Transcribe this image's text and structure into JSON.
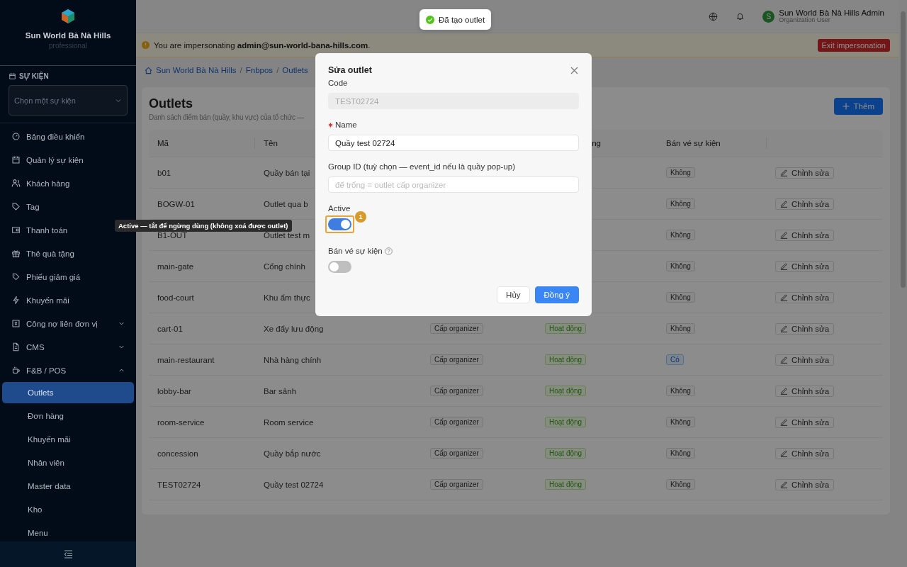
{
  "sidebar": {
    "brand": "Sun World Bà Nà Hills",
    "plan": "professional",
    "section_label": "SỰ KIỆN",
    "event_select": {
      "placeholder": "Chọn một sự kiện"
    },
    "items": [
      {
        "label": "Bảng điều khiển",
        "selected": false
      },
      {
        "label": "Quản lý sự kiện",
        "selected": false
      },
      {
        "label": "Khách hàng",
        "selected": false
      },
      {
        "label": "Tag",
        "selected": false
      },
      {
        "label": "Thanh toán",
        "selected": false
      },
      {
        "label": "Thẻ quà tặng",
        "selected": false
      },
      {
        "label": "Phiếu giảm giá",
        "selected": false
      },
      {
        "label": "Khuyến mãi",
        "selected": false
      },
      {
        "label": "Công nợ liên đơn vị",
        "selected": false,
        "expanded": false
      },
      {
        "label": "CMS",
        "selected": false,
        "expanded": false
      },
      {
        "label": "F&B / POS",
        "selected": false,
        "expanded": true,
        "children": [
          {
            "label": "Outlets",
            "selected": true
          },
          {
            "label": "Đơn hàng",
            "selected": false
          },
          {
            "label": "Khuyến mãi",
            "selected": false
          },
          {
            "label": "Nhân viên",
            "selected": false
          },
          {
            "label": "Master data",
            "selected": false
          },
          {
            "label": "Kho",
            "selected": false
          },
          {
            "label": "Menu",
            "selected": false
          }
        ]
      }
    ]
  },
  "header": {
    "user_initial": "S",
    "user_name": "Sun World Bà Nà Hills Admin",
    "user_role": "Organization User"
  },
  "toast": "Đã tạo outlet",
  "banner": {
    "message": "You are impersonating **admin@sun-world-bana-hills.com**.",
    "button": "Exit impersonation"
  },
  "breadcrumb": [
    "Sun World Bà Nà Hills",
    "/",
    "Fnbpos",
    "/",
    "Outlets"
  ],
  "page": {
    "title": "Outlets",
    "subtitle": "Danh sách điểm bán (quầy, khu vực) của tổ chức —",
    "add_button": "Thêm"
  },
  "table": {
    "columns": [
      {
        "label": "Mã"
      },
      {
        "label": "Tên"
      },
      {},
      {
        "label": "ng",
        "clipped": true
      },
      {
        "label": "Bán vé sự kiện"
      },
      {}
    ],
    "rows": [
      {
        "code": "b01",
        "name": "Quầy bán tại",
        "ticket": {
          "label": "Không",
          "on": false
        },
        "action": "Chỉnh sửa"
      },
      {
        "code": "BOGW-01",
        "name": "Outlet qua b",
        "ticket": {
          "label": "Không",
          "on": false
        },
        "action": "Chỉnh sửa"
      },
      {
        "code": "B1-OUT",
        "name": "Outlet test m",
        "ticket": {
          "label": "Không",
          "on": false
        },
        "action": "Chỉnh sửa"
      },
      {
        "code": "main-gate",
        "name": "Cổng chính",
        "ticket": {
          "label": "Không",
          "on": false
        },
        "action": "Chỉnh sửa"
      },
      {
        "code": "food-court",
        "name": "Khu ẩm thực",
        "ticket": {
          "label": "Không",
          "on": false
        },
        "action": "Chỉnh sửa"
      },
      {
        "code": "cart-01",
        "name": "Xe đẩy lưu động",
        "scope": "Cấp organizer",
        "status": "Hoạt động",
        "ticket": {
          "label": "Không",
          "on": false
        },
        "action": "Chỉnh sửa"
      },
      {
        "code": "main-restaurant",
        "name": "Nhà hàng chính",
        "scope": "Cấp organizer",
        "status": "Hoạt động",
        "ticket": {
          "label": "Có",
          "on": true
        },
        "action": "Chỉnh sửa"
      },
      {
        "code": "lobby-bar",
        "name": "Bar sảnh",
        "scope": "Cấp organizer",
        "status": "Hoạt động",
        "ticket": {
          "label": "Không",
          "on": false
        },
        "action": "Chỉnh sửa"
      },
      {
        "code": "room-service",
        "name": "Room service",
        "scope": "Cấp organizer",
        "status": "Hoạt động",
        "ticket": {
          "label": "Không",
          "on": false
        },
        "action": "Chỉnh sửa"
      },
      {
        "code": "concession",
        "name": "Quầy bắp nước",
        "scope": "Cấp organizer",
        "status": "Hoạt động",
        "ticket": {
          "label": "Không",
          "on": false
        },
        "action": "Chỉnh sửa"
      },
      {
        "code": "TEST02724",
        "name": "Quầy test 02724",
        "scope": "Cấp organizer",
        "status": "Hoạt động",
        "ticket": {
          "label": "Không",
          "on": false
        },
        "action": "Chỉnh sửa"
      }
    ]
  },
  "modal": {
    "title": "Sửa outlet",
    "fields": [
      {
        "kind": "text",
        "label": "Code",
        "value": "TEST02724",
        "disabled": true,
        "required": false
      },
      {
        "kind": "text",
        "label": "Name",
        "value": "Quầy test 02724",
        "disabled": false,
        "required": true
      },
      {
        "kind": "text",
        "label": "Group ID (tuỳ chọn — event_id nếu là quầy pop-up)",
        "placeholder": "để trống = outlet cấp organizer",
        "disabled": false,
        "required": false
      },
      {
        "kind": "switch",
        "label": "Active",
        "on": true,
        "highlighted": true,
        "badge": "1"
      },
      {
        "kind": "switch",
        "label": "Bán vé sự kiện",
        "on": false,
        "help": true
      }
    ],
    "cancel": "Hủy",
    "ok": "Đồng ý"
  },
  "tooltip": "Active — tắt để ngừng dùng (không xoá được outlet)"
}
